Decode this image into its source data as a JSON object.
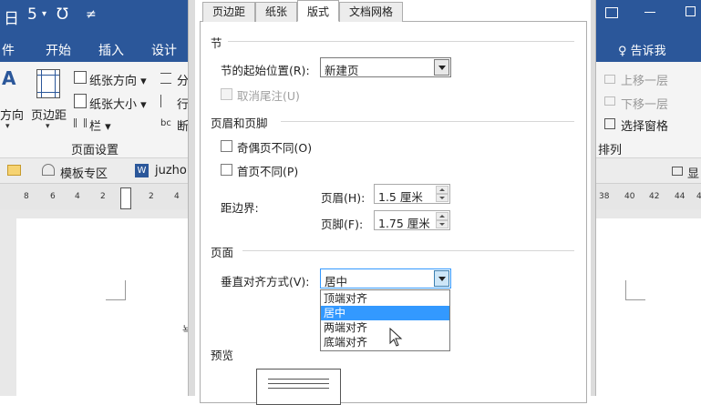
{
  "word": {
    "quick_access": {
      "save": "日",
      "undo": "5",
      "redo": "Ʊ",
      "customize": "≠"
    },
    "tabs": [
      "件",
      "开始",
      "插入",
      "设计"
    ],
    "tell_me": "♀ 告诉我",
    "ribbon_left": {
      "big_a": "A",
      "margins_partial": "方向",
      "margins_caret": "▾",
      "page_margin": "页边距",
      "page_margin_caret": "▾",
      "orientation": "纸张方向 ▾",
      "size": "纸张大小 ▾",
      "columns": "栏 ▾",
      "breaks_partial": "分",
      "line_partial": "行",
      "hyph_partial": "断",
      "bc_glyph": "bc",
      "group_label": "页面设置"
    },
    "ribbon_right": {
      "bring_forward": "上移一层",
      "send_backward": "下移一层",
      "selection_pane": "选择窗格",
      "group_label": "排列"
    },
    "doc_tabs": {
      "template_zone": "模板专区",
      "doc_partial": "juzho",
      "right_partial": "显"
    },
    "ruler_left": [
      "8",
      "6",
      "4",
      "2",
      "2",
      "4"
    ],
    "ruler_right": [
      "38",
      "40",
      "42",
      "44",
      "4"
    ],
    "doc_glyph": "뇩"
  },
  "dialog": {
    "tabs": [
      "页边距",
      "纸张",
      "版式",
      "文档网格"
    ],
    "active_tab": 2,
    "section": {
      "header": "节",
      "start_label": "节的起始位置(R):",
      "start_value": "新建页",
      "suppress_endnotes": "取消尾注(U)"
    },
    "headers_footers": {
      "header": "页眉和页脚",
      "odd_even": "奇偶页不同(O)",
      "first_page": "首页不同(P)",
      "from_edge": "距边界:",
      "header_label": "页眉(H):",
      "header_value": "1.5 厘米",
      "footer_label": "页脚(F):",
      "footer_value": "1.75 厘米"
    },
    "page": {
      "header": "页面",
      "valign_label": "垂直对齐方式(V):",
      "valign_value": "居中",
      "options": [
        "顶端对齐",
        "居中",
        "两端对齐",
        "底端对齐"
      ],
      "selected_option": 1
    },
    "preview": {
      "header": "预览"
    }
  },
  "colors": {
    "word_blue": "#2b579a",
    "selection_blue": "#3399ff"
  }
}
